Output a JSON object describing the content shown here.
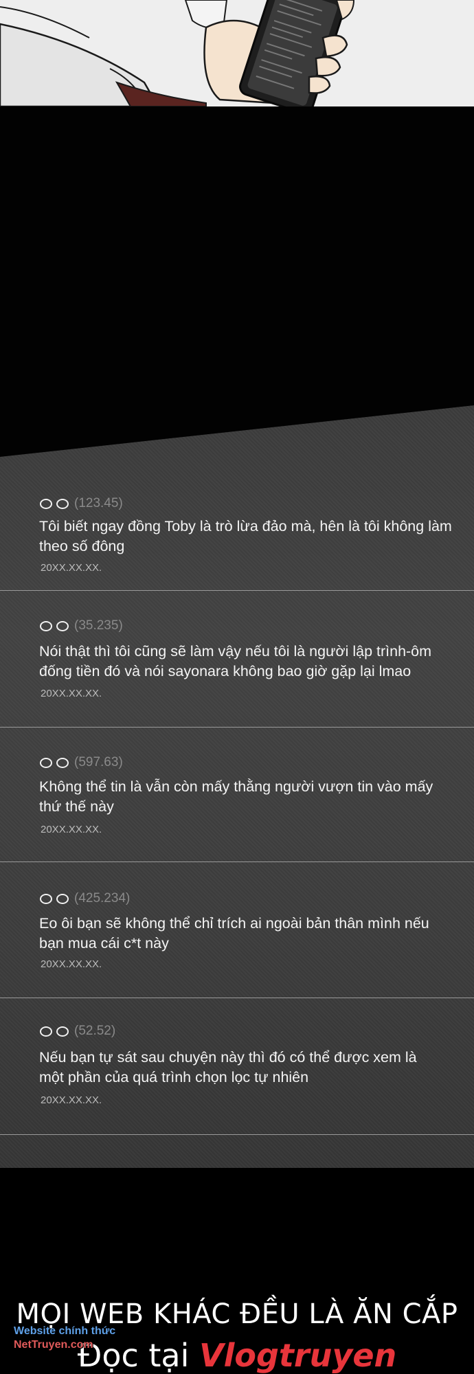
{
  "comments": [
    {
      "score": "(123.45)",
      "text_line1": "Tôi biết ngay đồng Toby là trò lừa đảo mà, hên là tôi không làm",
      "text_line2": "theo số đông",
      "date": "20XX.XX.XX."
    },
    {
      "score": "(35.235)",
      "text_line1": "Nói thật thì tôi cũng sẽ làm vậy nếu tôi là người lập trình-ôm",
      "text_line2": "đống tiền đó và nói sayonara không bao giờ gặp lại lmao",
      "date": "20XX.XX.XX."
    },
    {
      "score": "(597.63)",
      "text_line1": "Không thể tin là vẫn còn mấy thằng người vượn tin vào mấy",
      "text_line2": "thứ thế này",
      "date": "20XX.XX.XX."
    },
    {
      "score": "(425.234)",
      "text_line1": "Eo ôi bạn sẽ không thể chỉ trích ai ngoài bản thân mình nếu",
      "text_line2": "bạn mua cái c*t này",
      "date": "20XX.XX.XX."
    },
    {
      "score": "(52.52)",
      "text_line1": "Nếu bạn tự sát sau chuyện này thì đó có thể được xem là",
      "text_line2": "một phần của quá trình chọn lọc tự nhiên",
      "date": "20XX.XX.XX."
    }
  ],
  "footer": {
    "line1": "MỌI WEB KHÁC ĐỀU LÀ ĂN CẮP",
    "line2_prefix": "Đọc tại ",
    "line2_brand": "Vlogtruyen"
  },
  "watermark": {
    "line1": "Website chính thức",
    "line2": "NetTruyen.com"
  }
}
